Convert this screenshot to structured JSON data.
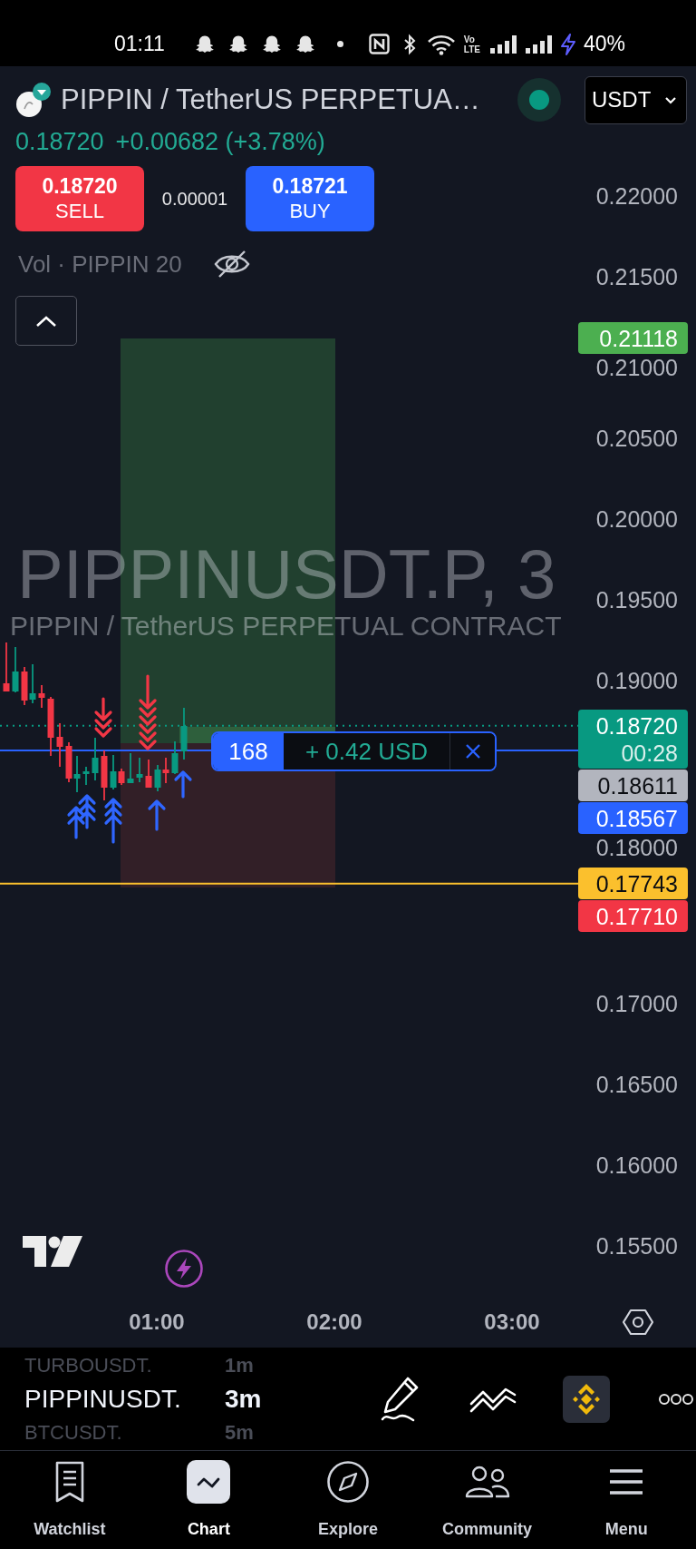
{
  "status_bar": {
    "time": "01:11",
    "network": [
      "Vo",
      "LTE"
    ],
    "battery": "40%"
  },
  "header": {
    "symbol": "PIPPIN / TetherUS PERPETUA…",
    "market_open": true,
    "currency": "USDT"
  },
  "quote": {
    "last": "0.18720",
    "change": "+0.00682 (+3.78%)"
  },
  "trade_buttons": [
    {
      "kind": "sell",
      "price": "0.18720",
      "label": "SELL"
    },
    {
      "kind": "buy",
      "price": "0.18721",
      "label": "BUY"
    }
  ],
  "spread": "0.00001",
  "indicator": {
    "label": "Vol · PIPPIN 20",
    "hidden": true
  },
  "chart": {
    "watermark": {
      "symbol": "PIPPINUSDT.P, 3",
      "description": "PIPPIN / TetherUS PERPETUAL CONTRACT"
    },
    "price_axis": [
      "0.22000",
      "0.21500",
      "0.21000",
      "0.20500",
      "0.20000",
      "0.19500",
      "0.19000",
      "0.18000",
      "0.17000",
      "0.16500",
      "0.16000",
      "0.15500"
    ],
    "price_tags": [
      {
        "kind": "label",
        "text": "0.21118",
        "color": "#4caf50"
      },
      {
        "kind": "dotted_line",
        "text": "0.18720",
        "countdown": "00:28",
        "color": "#089981"
      },
      {
        "kind": "label",
        "text": "0.18611",
        "color": "#b2b5be"
      },
      {
        "kind": "solid_line",
        "text": "0.18567",
        "color": "#2962ff"
      },
      {
        "kind": "solid_line",
        "text": "0.17743",
        "color": "#fbc02d"
      },
      {
        "kind": "label",
        "text": "0.17710",
        "color": "#f23645"
      }
    ],
    "position": {
      "quantity": "168",
      "pnl": "+ 0.42 USD"
    },
    "time_axis": [
      "01:00",
      "02:00",
      "03:00"
    ]
  },
  "symbol_picker": [
    {
      "symbol": "TURBOUSDT.",
      "interval": "1m",
      "selected": false
    },
    {
      "symbol": "PIPPINUSDT.",
      "interval": "3m",
      "selected": true
    },
    {
      "symbol": "BTCUSDT.",
      "interval": "5m",
      "selected": false
    }
  ],
  "bottom_nav": [
    {
      "label": "Watchlist",
      "selected": false
    },
    {
      "label": "Chart",
      "selected": true
    },
    {
      "label": "Explore",
      "selected": false
    },
    {
      "label": "Community",
      "selected": false
    },
    {
      "label": "Menu",
      "selected": false
    }
  ]
}
